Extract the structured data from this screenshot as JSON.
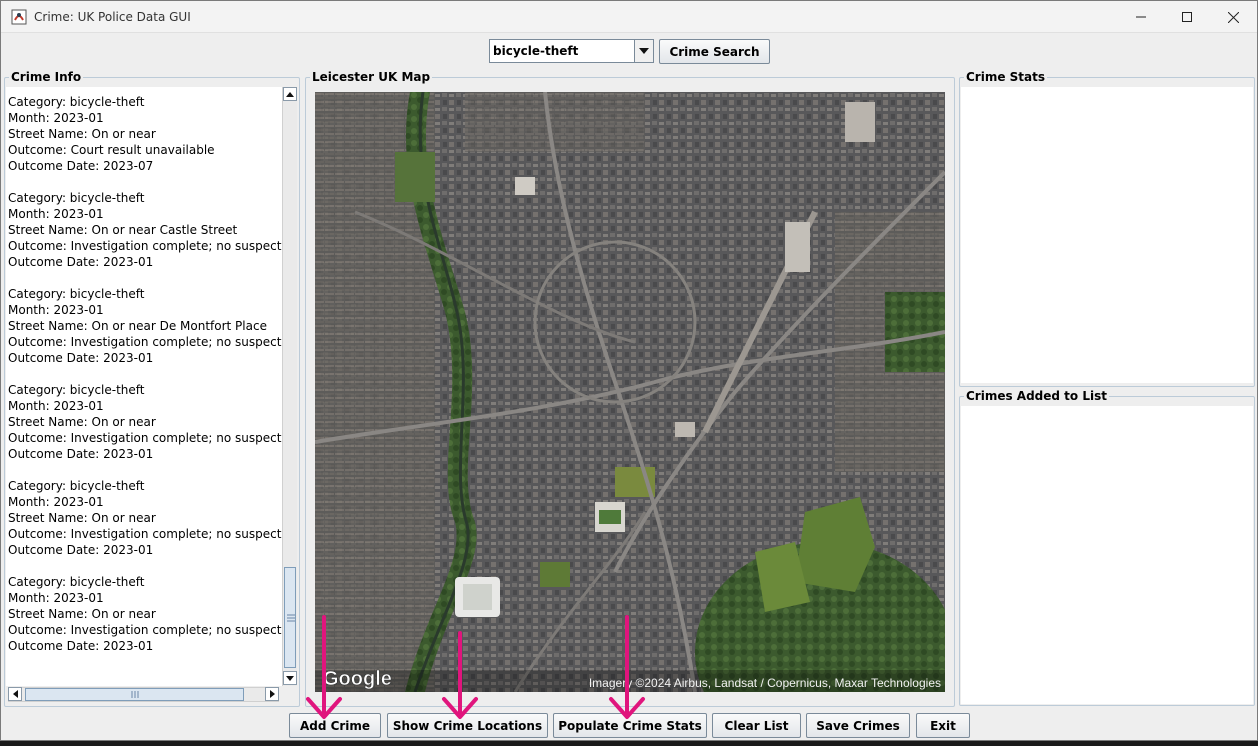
{
  "window": {
    "title": "Crime: UK Police Data GUI",
    "controls": [
      "minimize",
      "maximize",
      "close"
    ]
  },
  "search": {
    "selected_category": "bicycle-theft",
    "search_button": "Crime Search"
  },
  "crime_info": {
    "title": "Crime Info",
    "records": [
      {
        "category": "Category: bicycle-theft",
        "month": "Month: 2023-01",
        "street": "Street Name: On or near",
        "outcome": "Outcome: Court result unavailable",
        "outcome_date": "Outcome Date: 2023-07"
      },
      {
        "category": "Category: bicycle-theft",
        "month": "Month: 2023-01",
        "street": "Street Name: On or near Castle Street",
        "outcome": "Outcome: Investigation complete; no suspect iden",
        "outcome_date": "Outcome Date: 2023-01"
      },
      {
        "category": "Category: bicycle-theft",
        "month": "Month: 2023-01",
        "street": "Street Name: On or near De Montfort Place",
        "outcome": "Outcome: Investigation complete; no suspect iden",
        "outcome_date": "Outcome Date: 2023-01"
      },
      {
        "category": "Category: bicycle-theft",
        "month": "Month: 2023-01",
        "street": "Street Name: On or near",
        "outcome": "Outcome: Investigation complete; no suspect iden",
        "outcome_date": "Outcome Date: 2023-01"
      },
      {
        "category": "Category: bicycle-theft",
        "month": "Month: 2023-01",
        "street": "Street Name: On or near",
        "outcome": "Outcome: Investigation complete; no suspect iden",
        "outcome_date": "Outcome Date: 2023-01"
      },
      {
        "category": "Category: bicycle-theft",
        "month": "Month: 2023-01",
        "street": "Street Name: On or near",
        "outcome": "Outcome: Investigation complete; no suspect iden",
        "outcome_date": "Outcome Date: 2023-01"
      }
    ]
  },
  "map": {
    "title": "Leicester UK Map",
    "logo": "Google",
    "attribution": "Imagery ©2024 Airbus, Landsat / Copernicus, Maxar Technologies"
  },
  "stats": {
    "title": "Crime Stats"
  },
  "added": {
    "title": "Crimes Added to List"
  },
  "buttons": {
    "add": "Add Crime",
    "show_locations": "Show Crime Locations",
    "populate_stats": "Populate Crime Stats",
    "clear": "Clear List",
    "save": "Save Crimes",
    "exit": "Exit"
  },
  "colors": {
    "arrow": "#e0157d",
    "panel_border": "#bccbd8"
  }
}
